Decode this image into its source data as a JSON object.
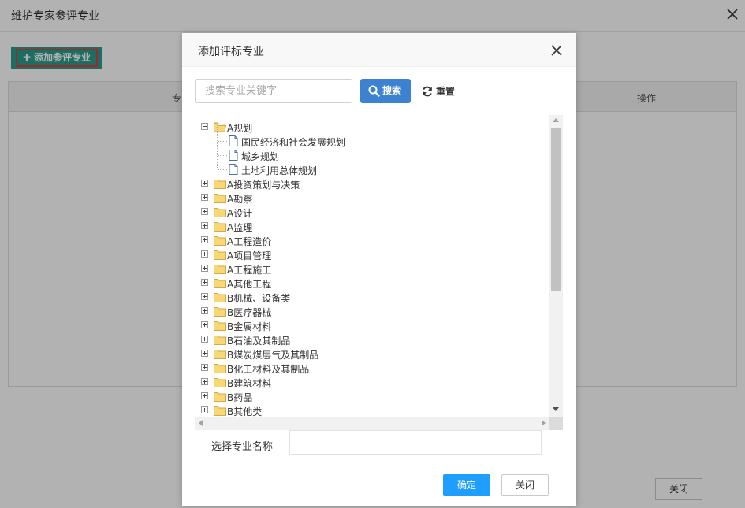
{
  "background": {
    "title": "维护专家参评专业",
    "add_button_label": "添加参评专业",
    "table_headers": [
      "专",
      "操作"
    ],
    "close_button_label": "关闭"
  },
  "modal": {
    "title": "添加评标专业",
    "search": {
      "placeholder": "搜索专业关键字",
      "value": "",
      "search_label": "搜索",
      "reset_label": "重置"
    },
    "tree": {
      "expanded": {
        "label": "A规划",
        "children": [
          "国民经济和社会发展规划",
          "城乡规划",
          "土地利用总体规划"
        ]
      },
      "collapsed": [
        "A投资策划与决策",
        "A勘察",
        "A设计",
        "A监理",
        "A工程造价",
        "A项目管理",
        "A工程施工",
        "A其他工程",
        "B机械、设备类",
        "B医疗器械",
        "B金属材料",
        "B石油及其制品",
        "B煤炭煤层气及其制品",
        "B化工材料及其制品",
        "B建筑材料",
        "B药品",
        "B其他类"
      ]
    },
    "select_label": "选择专业名称",
    "select_value": "",
    "confirm_label": "确定",
    "close_label": "关闭"
  },
  "colors": {
    "add_button": "#2a9c8f",
    "add_button_outline": "#e53935",
    "search_button": "#3d82d0",
    "confirm_button": "#1e9fff",
    "folder_fill": "#f8d775",
    "folder_stroke": "#d4a94a",
    "doc_stroke": "#4d6fa8"
  },
  "icons": {
    "close": "close-icon",
    "search": "search-icon",
    "reset": "refresh-icon",
    "folder": "folder-icon",
    "document": "document-icon",
    "plus": "plus-icon"
  }
}
